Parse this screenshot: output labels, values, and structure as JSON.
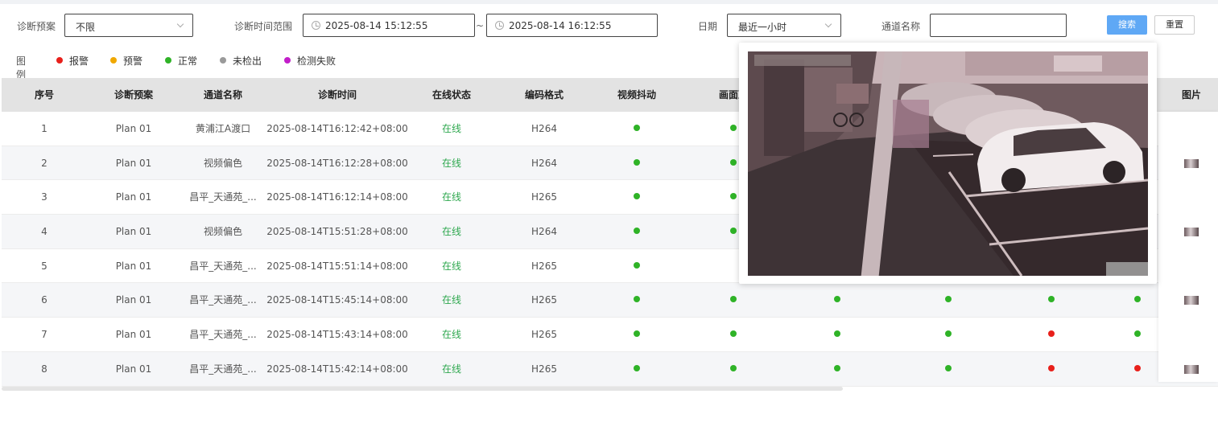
{
  "filters": {
    "plan_label": "诊断预案",
    "plan_value": "不限",
    "time_range_label": "诊断时间范围",
    "time_start": "2025-08-14 15:12:55",
    "time_sep": "~",
    "time_end": "2025-08-14 16:12:55",
    "date_label": "日期",
    "date_value": "最近一小时",
    "channel_label": "通道名称",
    "channel_value": "",
    "search_label": "搜索",
    "reset_label": "重置"
  },
  "legend": {
    "title": "图例",
    "items": [
      {
        "label": "报警",
        "color": "#e8201b"
      },
      {
        "label": "预警",
        "color": "#f0a800"
      },
      {
        "label": "正常",
        "color": "#2fb327"
      },
      {
        "label": "未检出",
        "color": "#9a9a9a"
      },
      {
        "label": "检测失败",
        "color": "#c21ec9"
      }
    ]
  },
  "table": {
    "headers": [
      "序号",
      "诊断预案",
      "通道名称",
      "诊断时间",
      "在线状态",
      "编码格式",
      "视频抖动",
      "画面冻",
      "",
      "",
      "",
      "!",
      "图片"
    ],
    "rows": [
      {
        "no": "1",
        "plan": "Plan 01",
        "channel": "黄浦江A渡口",
        "time": "2025-08-14T16:12:42+08:00",
        "status": "在线",
        "codec": "H264",
        "dots": [
          "green",
          "green",
          "",
          "",
          "",
          ""
        ],
        "thumb": false
      },
      {
        "no": "2",
        "plan": "Plan 01",
        "channel": "视频偏色",
        "time": "2025-08-14T16:12:28+08:00",
        "status": "在线",
        "codec": "H264",
        "dots": [
          "green",
          "green",
          "",
          "",
          "",
          ""
        ],
        "thumb": true
      },
      {
        "no": "3",
        "plan": "Plan 01",
        "channel": "昌平_天通苑_...",
        "time": "2025-08-14T16:12:14+08:00",
        "status": "在线",
        "codec": "H265",
        "dots": [
          "green",
          "green",
          "",
          "",
          "",
          ""
        ],
        "thumb": false
      },
      {
        "no": "4",
        "plan": "Plan 01",
        "channel": "视频偏色",
        "time": "2025-08-14T15:51:28+08:00",
        "status": "在线",
        "codec": "H264",
        "dots": [
          "green",
          "green",
          "",
          "",
          "",
          ""
        ],
        "thumb": true
      },
      {
        "no": "5",
        "plan": "Plan 01",
        "channel": "昌平_天通苑_...",
        "time": "2025-08-14T15:51:14+08:00",
        "status": "在线",
        "codec": "H265",
        "dots": [
          "green",
          "",
          "",
          "",
          "",
          ""
        ],
        "thumb": false
      },
      {
        "no": "6",
        "plan": "Plan 01",
        "channel": "昌平_天通苑_...",
        "time": "2025-08-14T15:45:14+08:00",
        "status": "在线",
        "codec": "H265",
        "dots": [
          "green",
          "green",
          "green",
          "green",
          "green",
          "green"
        ],
        "thumb": true
      },
      {
        "no": "7",
        "plan": "Plan 01",
        "channel": "昌平_天通苑_...",
        "time": "2025-08-14T15:43:14+08:00",
        "status": "在线",
        "codec": "H265",
        "dots": [
          "green",
          "green",
          "green",
          "green",
          "red",
          "green"
        ],
        "thumb": false
      },
      {
        "no": "8",
        "plan": "Plan 01",
        "channel": "昌平_天通苑_...",
        "time": "2025-08-14T15:42:14+08:00",
        "status": "在线",
        "codec": "H265",
        "dots": [
          "green",
          "green",
          "green",
          "green",
          "red",
          "red"
        ],
        "thumb": true
      }
    ]
  },
  "colors": {
    "green": "#2fb327",
    "red": "#e8201b",
    "accent": "#5fa8f5"
  },
  "preview": {
    "icon": "parking-lot-image"
  }
}
